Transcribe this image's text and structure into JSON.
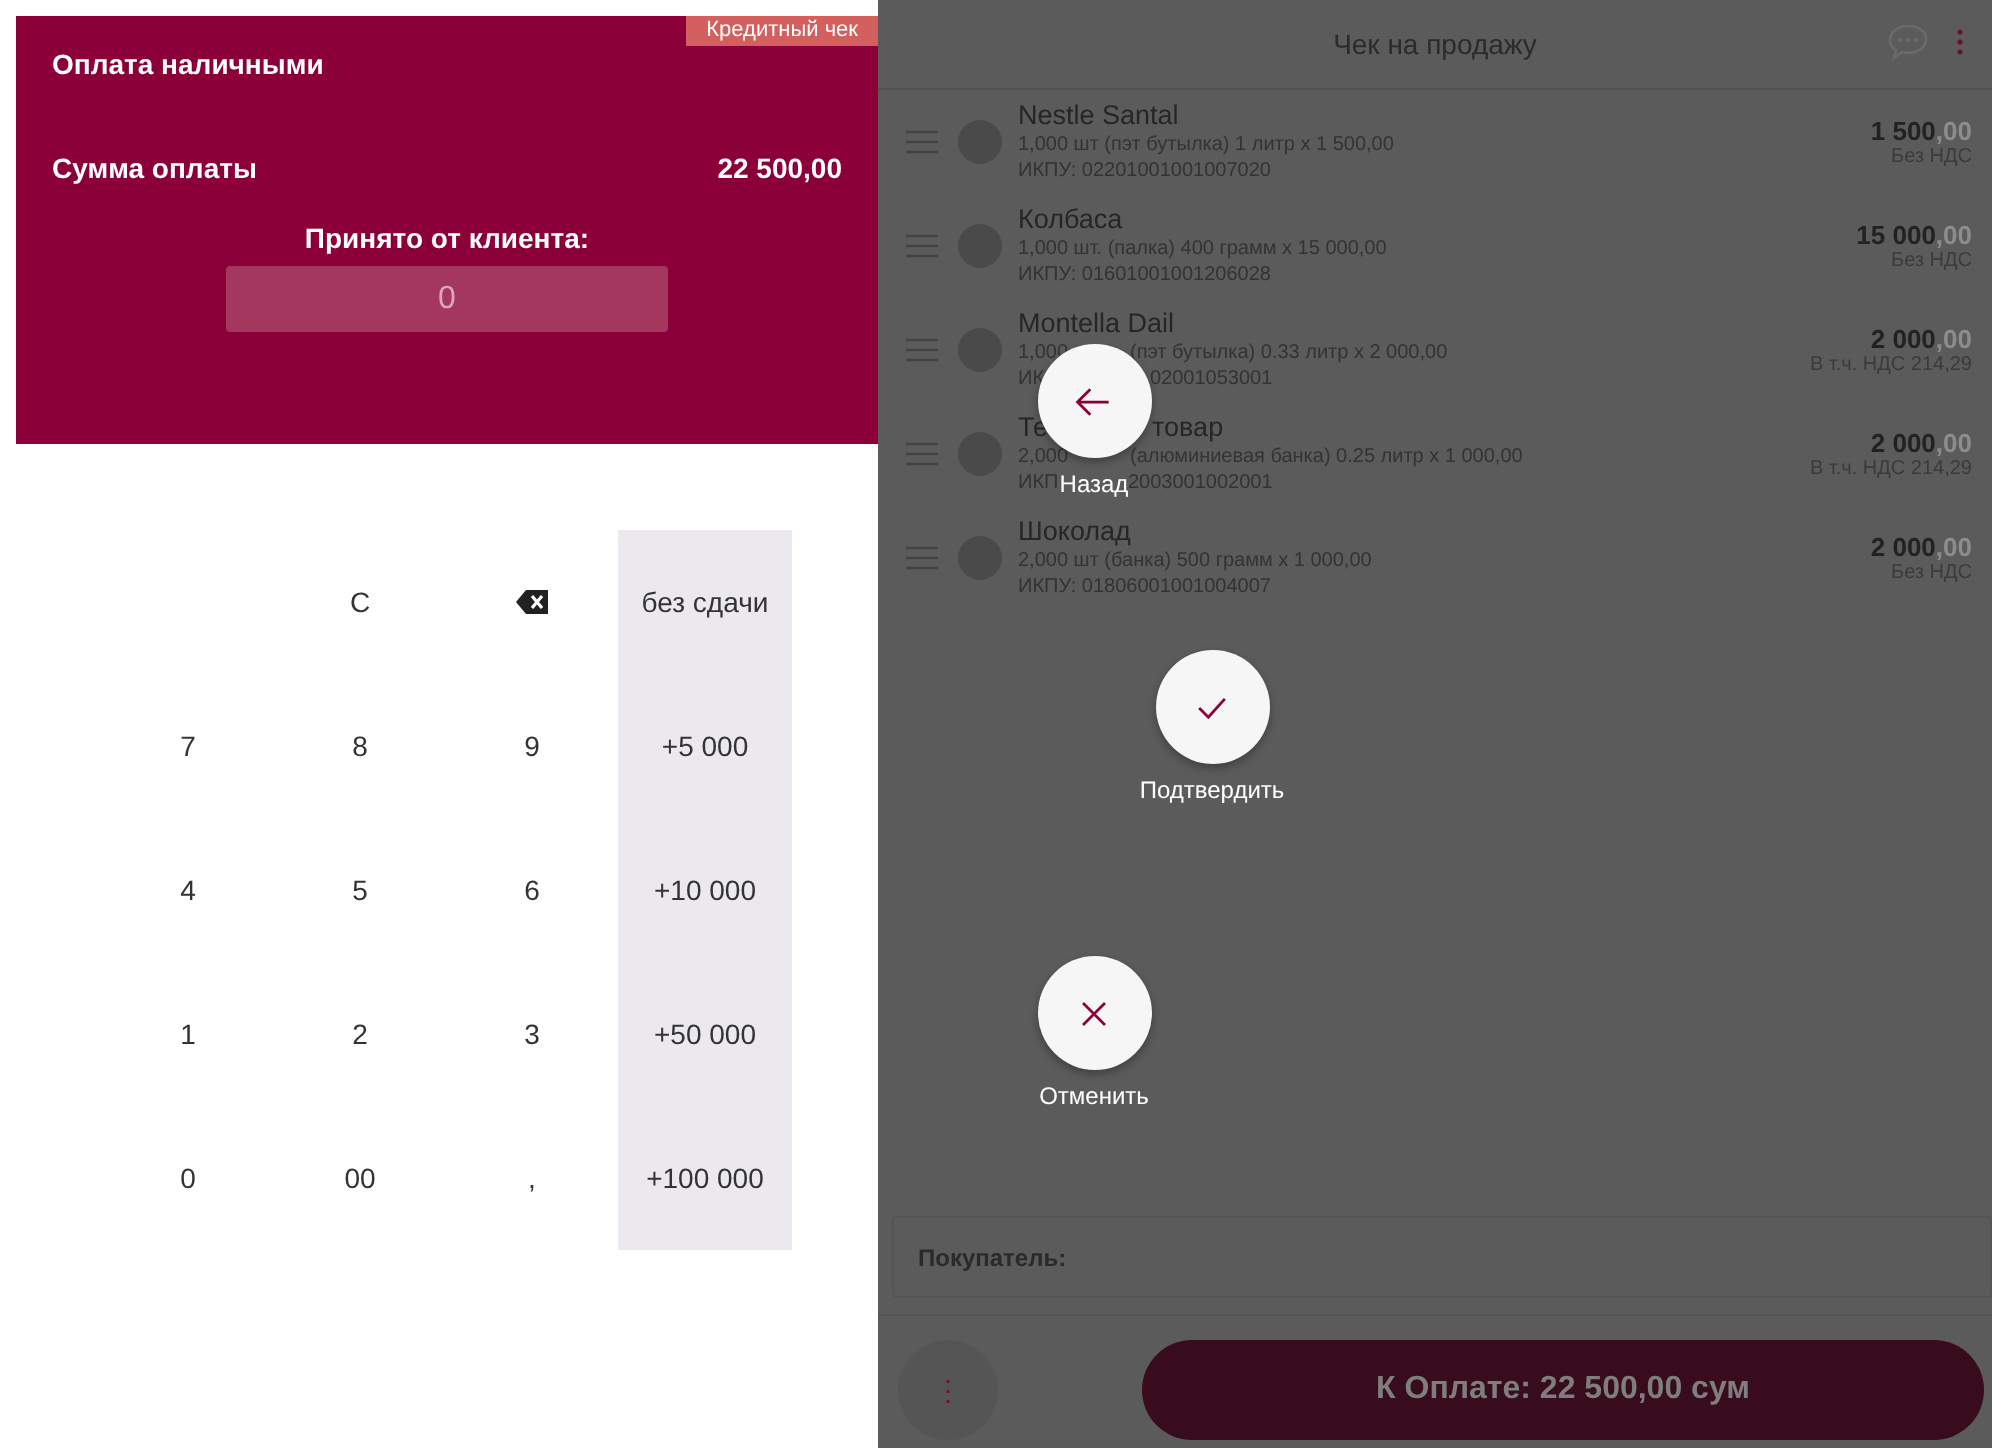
{
  "payment": {
    "title": "Оплата наличными",
    "badge": "Кредитный чек",
    "amount_label": "Сумма оплаты",
    "amount": "22 500,00",
    "received_label": "Принято от клиента:",
    "received_value": "0"
  },
  "keypad": {
    "rows": [
      [
        {
          "kind": "blank"
        },
        {
          "label": "C",
          "kind": "key"
        },
        {
          "kind": "backspace"
        }
      ],
      [
        {
          "label": "7",
          "kind": "key"
        },
        {
          "label": "8",
          "kind": "key"
        },
        {
          "label": "9",
          "kind": "key"
        }
      ],
      [
        {
          "label": "4",
          "kind": "key"
        },
        {
          "label": "5",
          "kind": "key"
        },
        {
          "label": "6",
          "kind": "key"
        }
      ],
      [
        {
          "label": "1",
          "kind": "key"
        },
        {
          "label": "2",
          "kind": "key"
        },
        {
          "label": "3",
          "kind": "key"
        }
      ],
      [
        {
          "label": "0",
          "kind": "key"
        },
        {
          "label": "00",
          "kind": "key"
        },
        {
          "label": ",",
          "kind": "key"
        }
      ]
    ],
    "quick": [
      "без сдачи",
      "+5 000",
      "+10 000",
      "+50 000",
      "+100 000"
    ]
  },
  "receipt": {
    "title": "Чек на продажу",
    "items": [
      {
        "name": [
          "Nestle Santal"
        ],
        "detail": [
          "1,000 шт (пэт бутылка) 1 литр x 1 500,00"
        ],
        "code": [
          "ИКПУ: 02201001001007020"
        ],
        "price": "1 500",
        "decimals": ",00",
        "vat": "Без НДС"
      },
      {
        "name": [
          "Колбаса"
        ],
        "detail": [
          "1,000 шт. (палка) 400 грамм x 15 000,00"
        ],
        "code": [
          "ИКПУ: 01601001001206028"
        ],
        "price": "15 000",
        "decimals": ",00",
        "vat": "Без НДС"
      },
      {
        "name": [
          "Montella Dail"
        ],
        "detail": [
          "1,000",
          "(пэт бутылка) 0.33 литр x 2 000,00"
        ],
        "code": [
          "ИК",
          "02001053001"
        ],
        "price": "2 000",
        "decimals": ",00",
        "vat": "В т.ч. НДС 214,29"
      },
      {
        "name": [
          "Те",
          "товар"
        ],
        "detail": [
          "2,000",
          "(алюминиевая банка) 0.25 литр x 1 000,00"
        ],
        "code": [
          "ИКП",
          "2003001002001"
        ],
        "price": "2 000",
        "decimals": ",00",
        "vat": "В т.ч. НДС 214,29"
      },
      {
        "name": [
          "Шоколад"
        ],
        "detail": [
          "2,000 шт (банка) 500 грамм x 1 000,00"
        ],
        "code": [
          "ИКПУ: 01806001001004007"
        ],
        "price": "2 000",
        "decimals": ",00",
        "vat": "Без НДС"
      }
    ],
    "buyer_label": "Покупатель:",
    "more_button": "⋮",
    "pay_button": "К Оплате: 22 500,00 сум"
  },
  "actions": [
    {
      "kind": "back",
      "label": "Назад"
    },
    {
      "kind": "confirm",
      "label": "Подтвердить"
    },
    {
      "kind": "cancel",
      "label": "Отменить"
    }
  ]
}
